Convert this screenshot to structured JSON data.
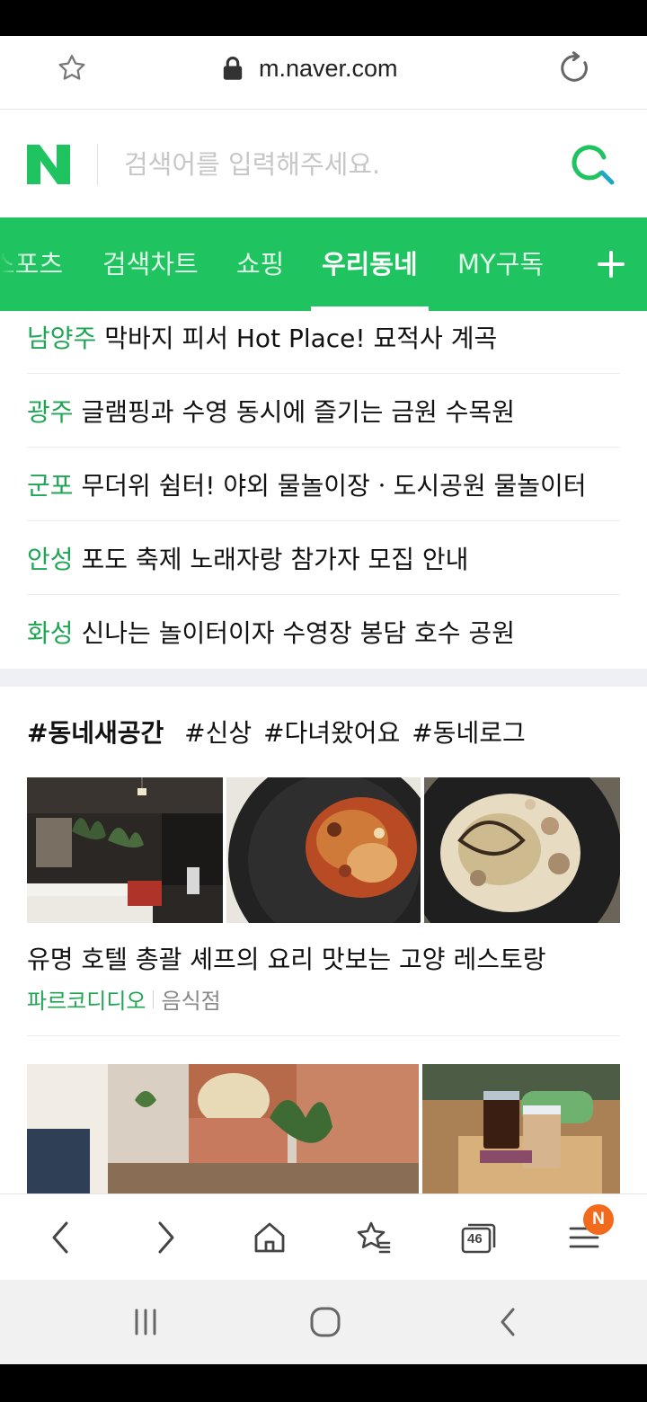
{
  "browser": {
    "url": "m.naver.com",
    "tab_count": "46",
    "menu_badge": "N"
  },
  "search": {
    "logo": "N",
    "placeholder": "검색어를 입력해주세요."
  },
  "tabs": [
    {
      "label": "스포츠"
    },
    {
      "label": "검색차트"
    },
    {
      "label": "쇼핑"
    },
    {
      "label": "우리동네",
      "active": true
    },
    {
      "label": "MY구독"
    }
  ],
  "news": [
    {
      "region": "남양주",
      "title": "막바지 피서 Hot Place! 묘적사 계곡"
    },
    {
      "region": "광주",
      "title": "글램핑과 수영 동시에 즐기는 금원 수목원"
    },
    {
      "region": "군포",
      "title": "무더위 쉼터! 야외 물놀이장ㆍ도시공원 물놀이터"
    },
    {
      "region": "안성",
      "title": "포도 축제 노래자랑 참가자 모집 안내"
    },
    {
      "region": "화성",
      "title": "신나는 놀이터이자 수영장 봉담 호수 공원"
    }
  ],
  "section": {
    "primary_tag": "#동네새공간",
    "tags": [
      "#신상",
      "#다녀왔어요",
      "#동네로그"
    ]
  },
  "cards": [
    {
      "title": "유명 호텔 총괄 셰프의 요리 맛보는 고양 레스토랑",
      "place": "파르코디디오",
      "category": "음식점"
    }
  ],
  "colors": {
    "naver_green": "#1fc35f",
    "region_green": "#1fa654",
    "badge_orange": "#f26a1b"
  },
  "icons": {
    "star": "star-icon",
    "lock": "lock-icon",
    "reload": "reload-icon",
    "search": "search-icon",
    "plus": "plus-icon",
    "back": "chevron-left-icon",
    "forward": "chevron-right-icon",
    "home": "home-icon",
    "bookmarks": "bookmark-star-icon",
    "tabs": "tabs-icon",
    "menu": "menu-icon"
  }
}
